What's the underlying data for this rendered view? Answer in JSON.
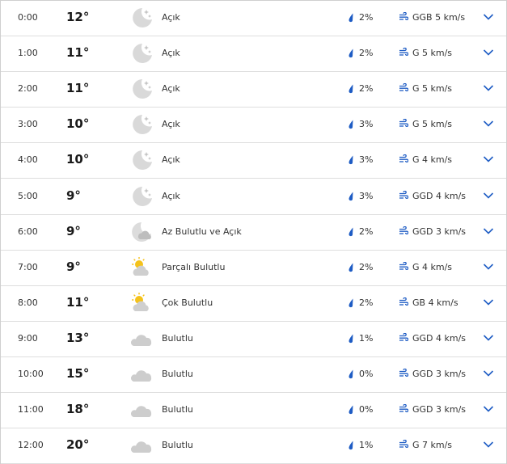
{
  "hours": [
    {
      "time": "0:00",
      "temp": "12°",
      "icon": "moon-clear-icon",
      "desc": "Açık",
      "rain": "2%",
      "wind": "GGB 5 km/s"
    },
    {
      "time": "1:00",
      "temp": "11°",
      "icon": "moon-clear-icon",
      "desc": "Açık",
      "rain": "2%",
      "wind": "G 5 km/s"
    },
    {
      "time": "2:00",
      "temp": "11°",
      "icon": "moon-clear-icon",
      "desc": "Açık",
      "rain": "2%",
      "wind": "G 5 km/s"
    },
    {
      "time": "3:00",
      "temp": "10°",
      "icon": "moon-clear-icon",
      "desc": "Açık",
      "rain": "3%",
      "wind": "G 5 km/s"
    },
    {
      "time": "4:00",
      "temp": "10°",
      "icon": "moon-clear-icon",
      "desc": "Açık",
      "rain": "3%",
      "wind": "G 4 km/s"
    },
    {
      "time": "5:00",
      "temp": "9°",
      "icon": "moon-clear-icon",
      "desc": "Açık",
      "rain": "3%",
      "wind": "GGD 4 km/s"
    },
    {
      "time": "6:00",
      "temp": "9°",
      "icon": "moon-cloud-icon",
      "desc": "Az Bulutlu ve Açık",
      "rain": "2%",
      "wind": "GGD 3 km/s"
    },
    {
      "time": "7:00",
      "temp": "9°",
      "icon": "sun-cloud-icon",
      "desc": "Parçalı Bulutlu",
      "rain": "2%",
      "wind": "G 4 km/s"
    },
    {
      "time": "8:00",
      "temp": "11°",
      "icon": "sun-cloud-icon",
      "desc": "Çok Bulutlu",
      "rain": "2%",
      "wind": "GB 4 km/s"
    },
    {
      "time": "9:00",
      "temp": "13°",
      "icon": "cloud-icon",
      "desc": "Bulutlu",
      "rain": "1%",
      "wind": "GGD 4 km/s"
    },
    {
      "time": "10:00",
      "temp": "15°",
      "icon": "cloud-icon",
      "desc": "Bulutlu",
      "rain": "0%",
      "wind": "GGD 3 km/s"
    },
    {
      "time": "11:00",
      "temp": "18°",
      "icon": "cloud-icon",
      "desc": "Bulutlu",
      "rain": "0%",
      "wind": "GGD 3 km/s"
    },
    {
      "time": "12:00",
      "temp": "20°",
      "icon": "cloud-icon",
      "desc": "Bulutlu",
      "rain": "1%",
      "wind": "G 7 km/s"
    }
  ],
  "colors": {
    "accent": "#1e5cc4",
    "icon_gray": "#c9c9c9",
    "sun": "#f4c21b",
    "text": "#333333",
    "divider": "#dedede"
  }
}
